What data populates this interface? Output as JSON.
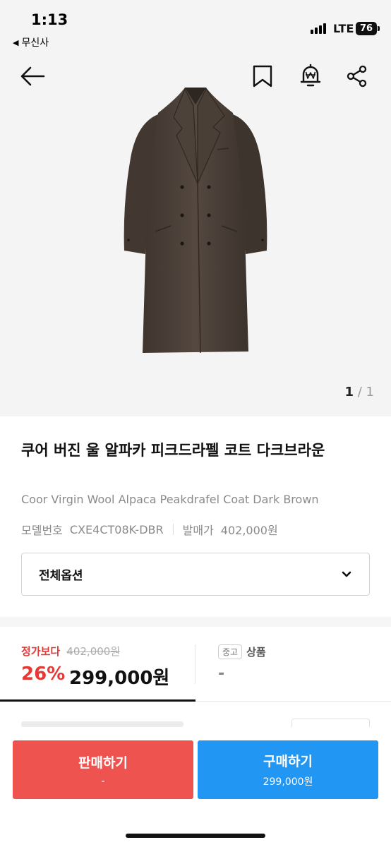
{
  "status_bar": {
    "time": "1:13",
    "back_app": "무신사",
    "network": "LTE",
    "battery": "76"
  },
  "nav": {
    "back_icon": "arrow-left-icon",
    "bookmark_icon": "bookmark-icon",
    "price_alert_icon": "won-bell-icon",
    "share_icon": "share-icon"
  },
  "gallery": {
    "current": "1",
    "separator": "/",
    "total": "1"
  },
  "product": {
    "title_ko": "쿠어 버진 울 알파카 피크드라펠 코트 다크브라운",
    "title_en": "Coor Virgin Wool Alpaca Peakdrafel Coat Dark Brown",
    "model_label": "모델번호",
    "model_number": "CXE4CT08K-DBR",
    "release_label": "발매가",
    "release_price": "402,000원",
    "option_label": "전체옵션"
  },
  "price": {
    "regular_label": "정가보다",
    "regular_price": "402,000원",
    "discount": "26%",
    "sale_price": "299,000원",
    "used_badge": "중고",
    "used_label": "상품",
    "used_value": "-"
  },
  "actions": {
    "sell_label": "판매하기",
    "sell_sub": "-",
    "buy_label": "구매하기",
    "buy_sub": "299,000원"
  },
  "colors": {
    "sell": "#ef5350",
    "buy": "#2196f3",
    "discount": "#e53935",
    "coat": "#4a3f37"
  }
}
